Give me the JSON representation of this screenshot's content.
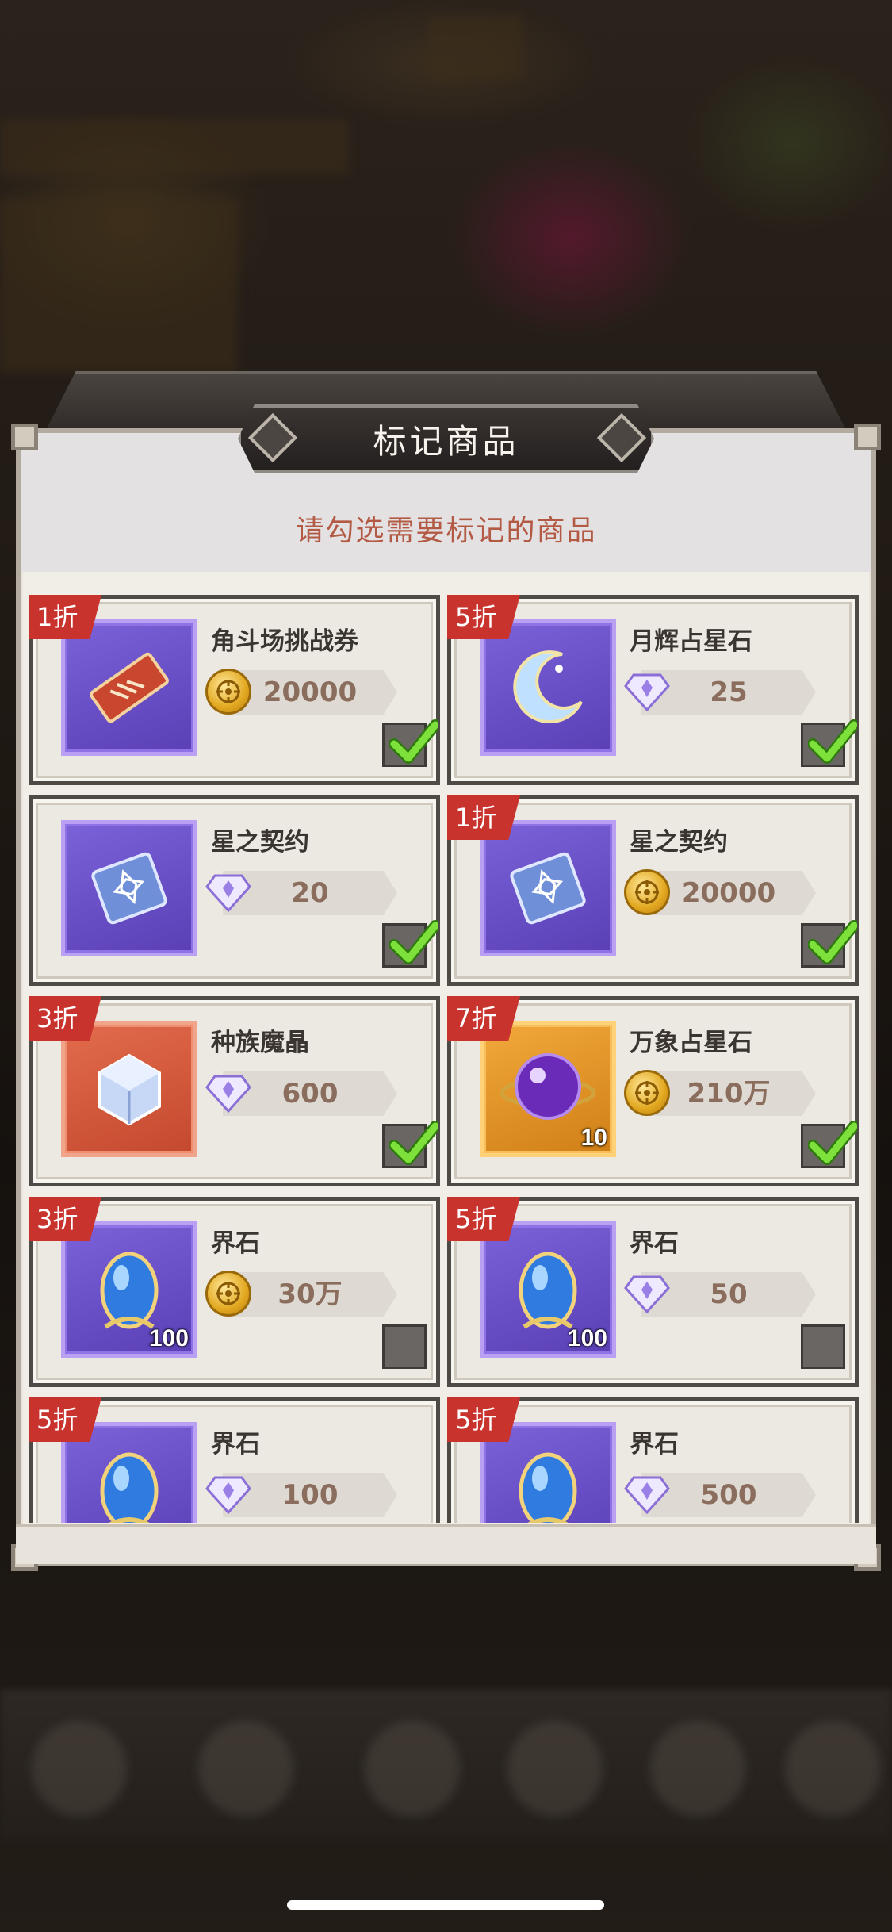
{
  "dialog": {
    "title": "标记商品",
    "subtitle": "请勾选需要标记的商品"
  },
  "colors": {
    "badge": "#c9332d",
    "subtitle": "#b35a45",
    "check_on": "#6fd62a",
    "thumb_purple": "#6a4fc8",
    "thumb_red": "#d65a3c",
    "thumb_gold": "#e6961f"
  },
  "items": [
    {
      "discount": "1折",
      "name": "角斗场挑战券",
      "currency": "gold-coin-icon",
      "price": "20000",
      "checked": true,
      "thumb": "purple",
      "icon": "ticket-icon",
      "qty": ""
    },
    {
      "discount": "5折",
      "name": "月辉占星石",
      "currency": "diamond-icon",
      "price": "25",
      "checked": true,
      "thumb": "purple",
      "icon": "crescent-moon-icon",
      "qty": ""
    },
    {
      "discount": "",
      "name": "星之契约",
      "currency": "diamond-icon",
      "price": "20",
      "checked": true,
      "thumb": "purple",
      "icon": "contract-book-icon",
      "qty": ""
    },
    {
      "discount": "1折",
      "name": "星之契约",
      "currency": "gold-coin-icon",
      "price": "20000",
      "checked": true,
      "thumb": "purple",
      "icon": "contract-book-icon",
      "qty": ""
    },
    {
      "discount": "3折",
      "name": "种族魔晶",
      "currency": "diamond-icon",
      "price": "600",
      "checked": true,
      "thumb": "red",
      "icon": "crystal-cube-icon",
      "qty": ""
    },
    {
      "discount": "7折",
      "name": "万象占星石",
      "currency": "gold-coin-icon",
      "price": "210万",
      "checked": true,
      "thumb": "gold",
      "icon": "purple-orb-icon",
      "qty": "10"
    },
    {
      "discount": "3折",
      "name": "界石",
      "currency": "gold-coin-icon",
      "price": "30万",
      "checked": false,
      "thumb": "purple",
      "icon": "blue-stone-icon",
      "qty": "100"
    },
    {
      "discount": "5折",
      "name": "界石",
      "currency": "diamond-icon",
      "price": "50",
      "checked": false,
      "thumb": "purple",
      "icon": "blue-stone-icon",
      "qty": "100"
    },
    {
      "discount": "5折",
      "name": "界石",
      "currency": "diamond-icon",
      "price": "100",
      "checked": false,
      "thumb": "purple",
      "icon": "blue-stone-icon",
      "qty": ""
    },
    {
      "discount": "5折",
      "name": "界石",
      "currency": "diamond-icon",
      "price": "500",
      "checked": false,
      "thumb": "purple",
      "icon": "blue-stone-icon",
      "qty": ""
    }
  ]
}
